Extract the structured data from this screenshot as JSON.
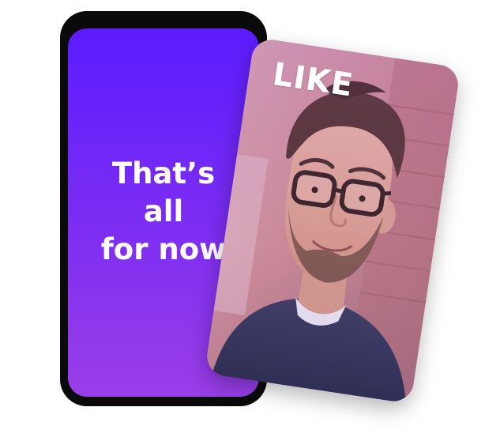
{
  "end_screen": {
    "line1": "That’s",
    "line2": "all",
    "line3": "for now"
  },
  "profile_card": {
    "badge_label": "LIKE",
    "photo_alt": "Smiling man with glasses",
    "swipe_action": "like"
  },
  "colors": {
    "phone_frame": "#0a0a0a",
    "screen_gradient_top": "#5b1cff",
    "screen_gradient_bottom": "#9a3ee8",
    "text": "#ffffff"
  }
}
